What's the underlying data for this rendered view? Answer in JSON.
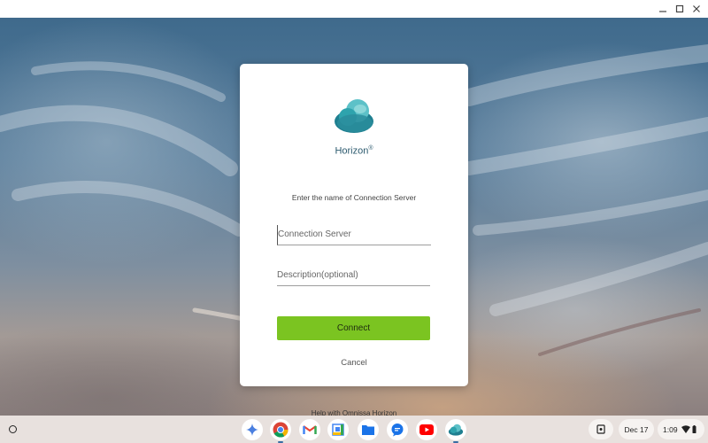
{
  "window": {
    "controls": [
      "minimize",
      "maximize",
      "close"
    ]
  },
  "dialog": {
    "brand_name": "Horizon",
    "brand_mark": "®",
    "prompt": "Enter the name of Connection Server",
    "server_field": {
      "placeholder": "Connection Server",
      "value": ""
    },
    "description_field": {
      "placeholder": "Description(optional)",
      "value": ""
    },
    "connect_label": "Connect",
    "cancel_label": "Cancel",
    "brand_color": "#2a8d9c",
    "connect_color": "#7bc421"
  },
  "help_link": "Help with Omnissa Horizon",
  "shelf": {
    "launcher": "launcher-icon",
    "apps": [
      {
        "name": "gemini-icon",
        "active": false
      },
      {
        "name": "chrome-icon",
        "active": true
      },
      {
        "name": "gmail-icon",
        "active": false
      },
      {
        "name": "calendar-icon",
        "active": false
      },
      {
        "name": "files-icon",
        "active": false
      },
      {
        "name": "messages-icon",
        "active": false
      },
      {
        "name": "youtube-icon",
        "active": false
      },
      {
        "name": "horizon-icon",
        "active": true
      }
    ],
    "date": "Dec 17",
    "time": "1:09"
  }
}
